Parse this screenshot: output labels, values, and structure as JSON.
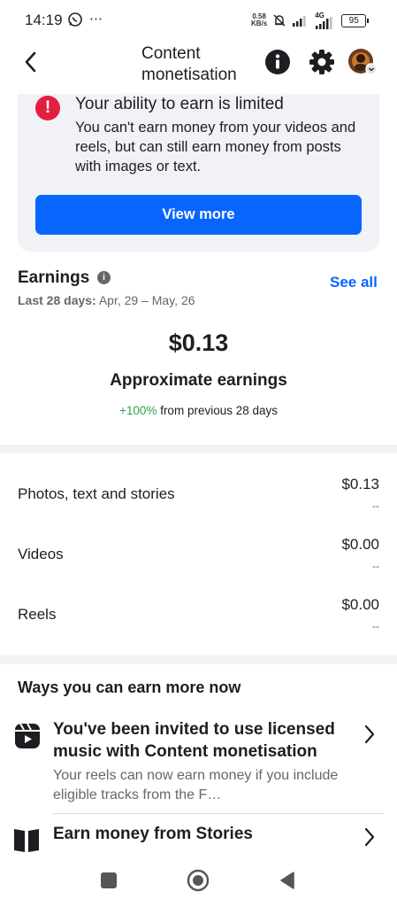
{
  "status_bar": {
    "time": "14:19",
    "extra": "⋯",
    "speed_value": "0.58",
    "speed_unit": "KB/s",
    "net_type": "4G",
    "battery": "95"
  },
  "header": {
    "title_line1": "Content",
    "title_line2": "monetisation",
    "back_icon": "chevron-left-icon",
    "info_icon": "info-icon",
    "settings_icon": "gear-icon",
    "avatar": "profile-avatar"
  },
  "limited_card": {
    "alert_glyph": "!",
    "title": "Your ability to earn is limited",
    "body": "You can't earn money from your videos and reels, but can still earn money from posts with images or text.",
    "button_label": "View more",
    "accent": "#0866ff",
    "alert_color": "#e41e3f"
  },
  "earnings": {
    "title": "Earnings",
    "see_all": "See all",
    "range_label": "Last 28 days:",
    "range_value": "Apr, 29 – May, 26",
    "amount": "$0.13",
    "amount_label": "Approximate earnings",
    "change_value": "+100%",
    "change_text": "from previous 28 days",
    "rows": [
      {
        "label": "Photos, text and stories",
        "value": "$0.13",
        "sub": "--"
      },
      {
        "label": "Videos",
        "value": "$0.00",
        "sub": "--"
      },
      {
        "label": "Reels",
        "value": "$0.00",
        "sub": "--"
      }
    ]
  },
  "ways": {
    "title": "Ways you can earn more now",
    "items": [
      {
        "icon": "reels-icon",
        "title": "You've been invited to use licensed music with Content monetisation",
        "subtitle": "Your reels can now earn money if you include eligible tracks from the F…"
      },
      {
        "icon": "book-icon",
        "title": "Earn money from Stories"
      }
    ]
  },
  "nav_bar": {
    "recents": "square-icon",
    "home": "circle-icon",
    "back": "triangle-back-icon"
  }
}
